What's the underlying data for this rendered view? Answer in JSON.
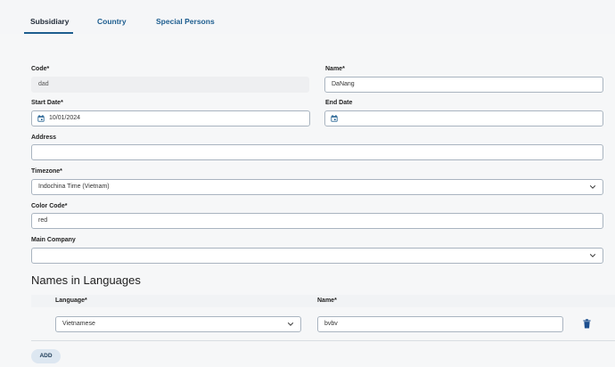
{
  "tabs": [
    "Subsidiary",
    "Country",
    "Special Persons"
  ],
  "form": {
    "code_label": "Code*",
    "code_value": "dad",
    "name_label": "Name*",
    "name_value": "DaNang",
    "start_date_label": "Start Date*",
    "start_date_value": "10/01/2024",
    "end_date_label": "End Date",
    "end_date_value": "",
    "address_label": "Address",
    "address_value": "",
    "timezone_label": "Timezone*",
    "timezone_value": "Indochina Time (Vietnam)",
    "color_code_label": "Color Code*",
    "color_code_value": "red",
    "main_company_label": "Main Company",
    "main_company_value": ""
  },
  "names_section": {
    "title": "Names in Languages",
    "columns": [
      "Language*",
      "Name*"
    ],
    "rows": [
      {
        "language": "Vietnamese",
        "name": "bvbv"
      }
    ],
    "add_label": "ADD"
  },
  "colors": {
    "accent": "#1d5d8f",
    "trash": "#1d4f8f"
  }
}
